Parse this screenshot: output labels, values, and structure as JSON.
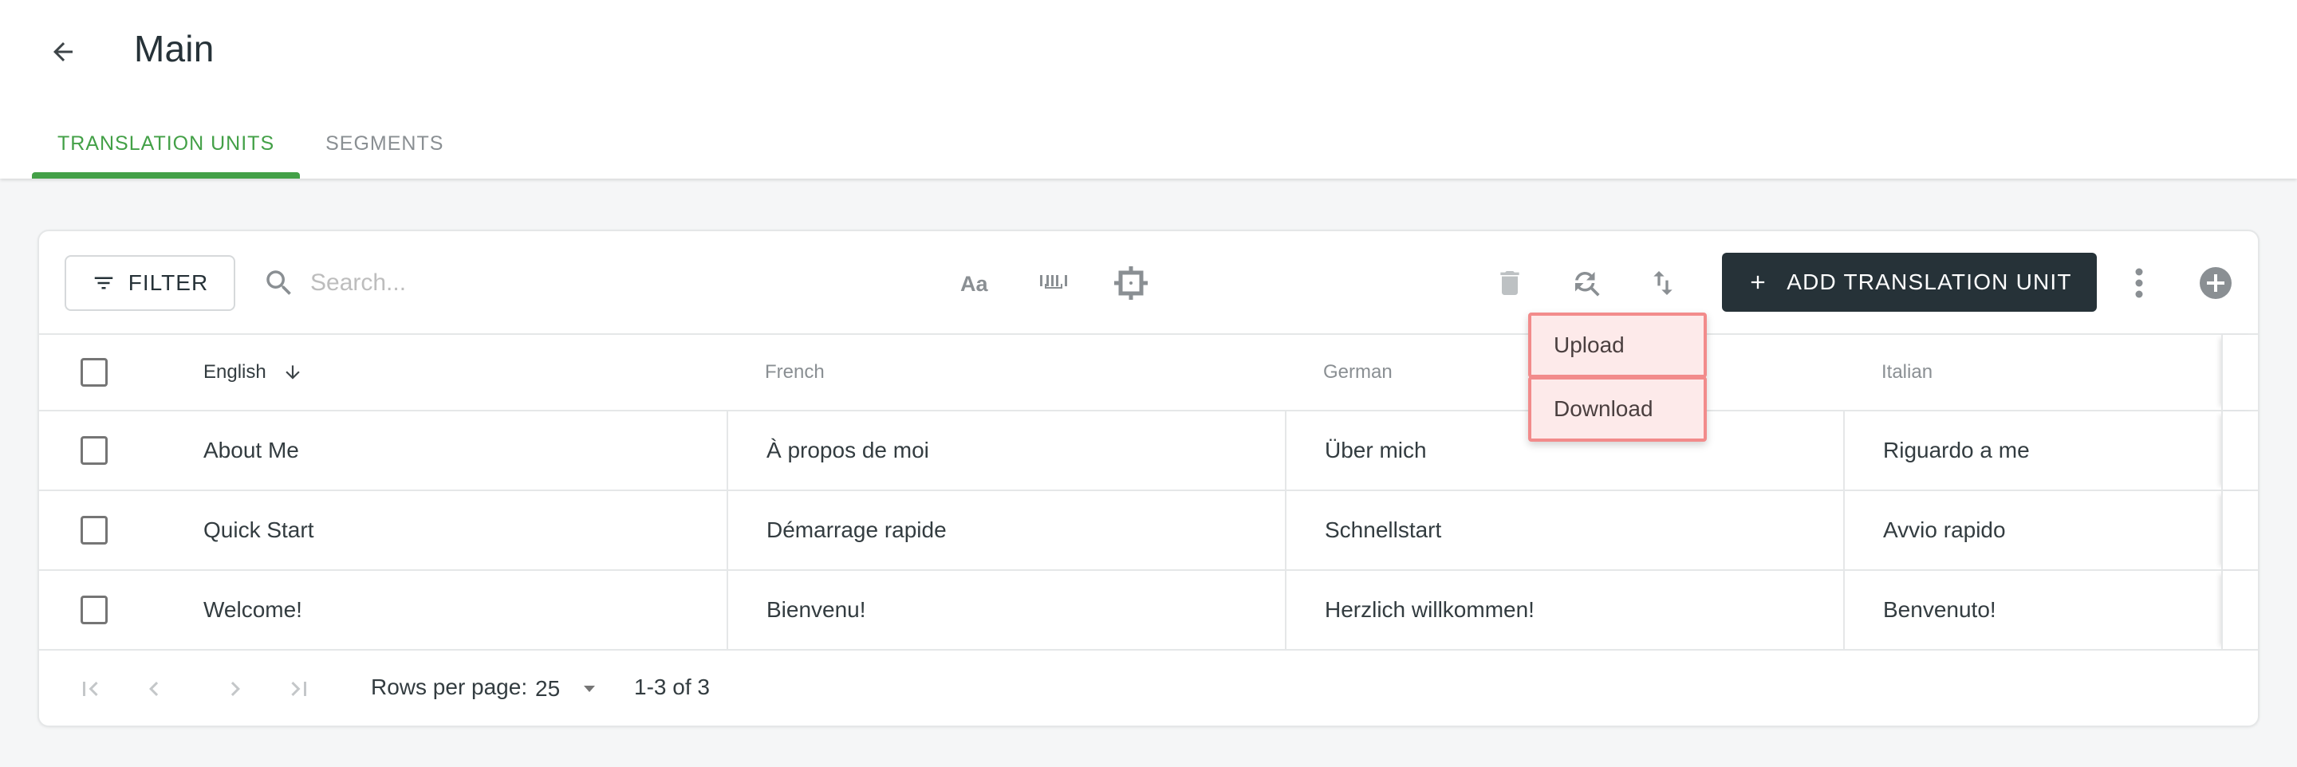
{
  "header": {
    "back_icon": "arrow-left-icon",
    "title": "Main",
    "tabs": [
      {
        "label": "TRANSLATION UNITS",
        "active": true
      },
      {
        "label": "SEGMENTS",
        "active": false
      }
    ]
  },
  "toolbar": {
    "filter_label": "FILTER",
    "search_placeholder": "Search...",
    "search_value": "",
    "icons": [
      "text-case-icon",
      "whitespace-icon",
      "focus-crop-icon",
      "delete-icon",
      "find-replace-icon",
      "import-export-icon",
      "more-vert-icon",
      "add-circle-icon"
    ],
    "add_label": "ADD TRANSLATION UNIT"
  },
  "import_export_menu": {
    "items": [
      "Upload",
      "Download"
    ]
  },
  "table": {
    "columns": [
      {
        "label": "English",
        "sorted": "desc"
      },
      {
        "label": "French"
      },
      {
        "label": "German"
      },
      {
        "label": "Italian"
      }
    ],
    "rows": [
      {
        "en": "About Me",
        "fr": "À propos de moi",
        "de": "Über mich",
        "it": "Riguardo a me"
      },
      {
        "en": "Quick Start",
        "fr": "Démarrage rapide",
        "de": "Schnellstart",
        "it": "Avvio rapido"
      },
      {
        "en": "Welcome!",
        "fr": "Bienvenu!",
        "de": "Herzlich willkommen!",
        "it": "Benvenuto!"
      }
    ]
  },
  "pagination": {
    "rows_per_page_label": "Rows per page:",
    "rows_per_page": "25",
    "range": "1-3 of 3"
  },
  "colors": {
    "accent": "#43a047",
    "primary_button": "#263238",
    "menu_highlight_border": "#f28b8b",
    "menu_highlight_bg": "#fdeaea"
  }
}
